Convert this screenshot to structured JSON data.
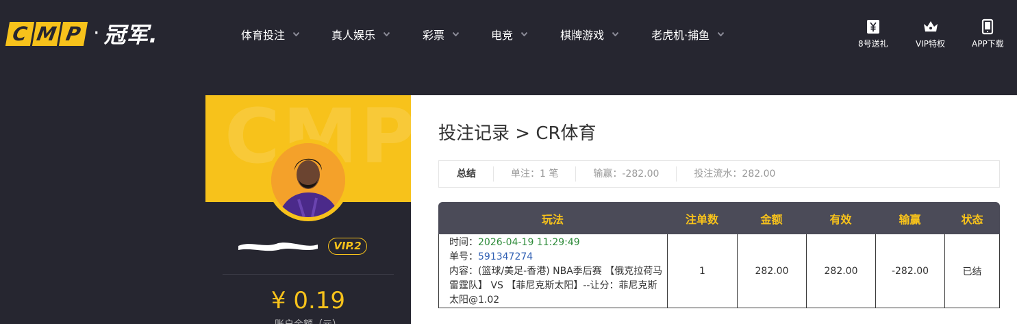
{
  "brand": {
    "logo_letters": [
      "C",
      "M",
      "P"
    ],
    "logo_dot": "·",
    "logo_cn": "冠军.",
    "accent": "#f7c21b",
    "bg": "#262630"
  },
  "nav": [
    {
      "label": "体育投注"
    },
    {
      "label": "真人娱乐"
    },
    {
      "label": "彩票"
    },
    {
      "label": "电竞"
    },
    {
      "label": "棋牌游戏"
    },
    {
      "label": "老虎机·捕鱼"
    }
  ],
  "quick_links": [
    {
      "label": "8号送礼",
      "icon": "yen-gift-icon"
    },
    {
      "label": "VIP特权",
      "icon": "crown-icon"
    },
    {
      "label": "APP下载",
      "icon": "tablet-icon"
    }
  ],
  "profile": {
    "watermark": "CMP",
    "vip_label": "VIP.2",
    "balance": "¥ 0.19",
    "balance_label": "账户余额（元）"
  },
  "main": {
    "title": "投注记录 > CR体育",
    "summary": {
      "label": "总结",
      "bets": "单注：1 笔",
      "win_loss": "输赢：-282.00",
      "turnover": "投注流水：282.00"
    },
    "table": {
      "headers": [
        "玩法",
        "注单数",
        "金额",
        "有效",
        "输赢",
        "状态"
      ],
      "rows": [
        {
          "time_label": "时间：",
          "time": "2026-04-19 11:29:49",
          "order_label": "单号：",
          "order": "591347274",
          "content": "内容：(篮球/美足-香港) NBA季后赛 【俄克拉荷马雷霆队】 VS 【菲尼克斯太阳】--让分：菲尼克斯太阳@1.02",
          "count": "1",
          "amount": "282.00",
          "valid": "282.00",
          "win_loss": "-282.00",
          "status": "已结"
        }
      ]
    }
  }
}
